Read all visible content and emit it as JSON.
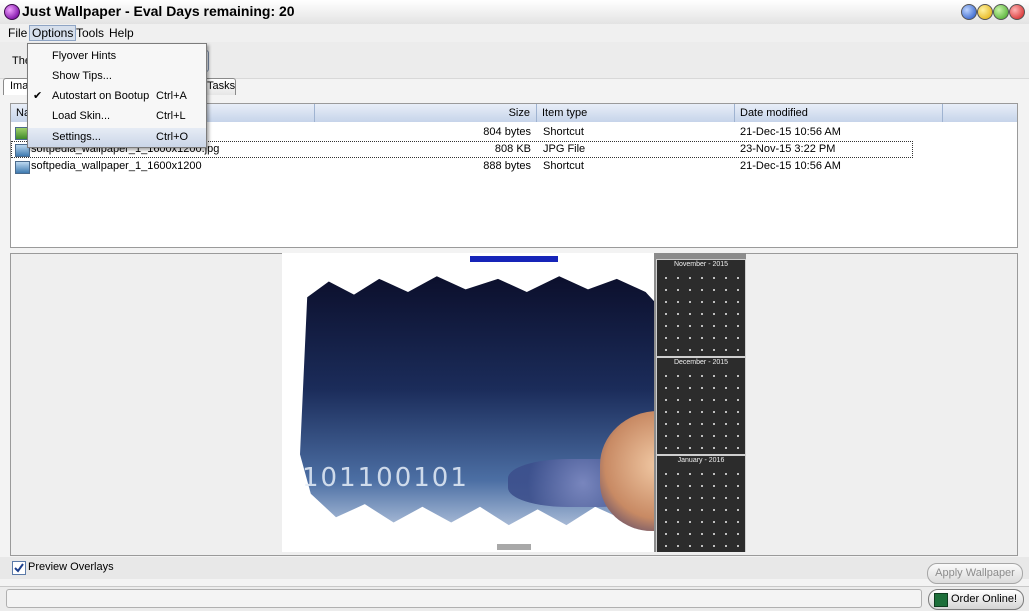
{
  "window": {
    "title": "Just Wallpaper - Eval Days remaining: 20"
  },
  "menubar": {
    "items": [
      "File",
      "Options",
      "Tools",
      "Help"
    ]
  },
  "toolbar": {
    "theme_label": "The"
  },
  "tabs": [
    {
      "label": "Imag"
    },
    {
      "label": "Tasks"
    }
  ],
  "options_menu": {
    "items": [
      {
        "label": "Flyover Hints",
        "shortcut": ""
      },
      {
        "label": "Show Tips...",
        "shortcut": ""
      },
      {
        "label": "Autostart on Bootup",
        "shortcut": "Ctrl+A",
        "checked": true
      },
      {
        "label": "Load Skin...",
        "shortcut": "Ctrl+L"
      },
      {
        "label": "Settings...",
        "shortcut": "Ctrl+O"
      }
    ],
    "check_mark": "✔"
  },
  "file_list": {
    "columns": [
      "Na",
      "Size",
      "Item type",
      "Date modified"
    ],
    "rows": [
      {
        "name": "",
        "size": "804 bytes",
        "type": "Shortcut",
        "date": "21-Dec-15 10:56 AM"
      },
      {
        "name": "softpedia_wallpaper_1_1600x1200.jpg",
        "size": "808 KB",
        "type": "JPG File",
        "date": "23-Nov-15 3:22 PM"
      },
      {
        "name": "softpedia_wallpaper_1_1600x1200",
        "size": "888 bytes",
        "type": "Shortcut",
        "date": "21-Dec-15 10:56 AM"
      }
    ]
  },
  "preview": {
    "calendars": [
      "November - 2015",
      "December - 2015",
      "January - 2016"
    ],
    "digits": "101100101"
  },
  "bottom": {
    "preview_overlays_label": "Preview Overlays",
    "preview_overlays_checked": true,
    "apply_label": "Apply Wallpaper",
    "order_label": "Order Online!"
  }
}
